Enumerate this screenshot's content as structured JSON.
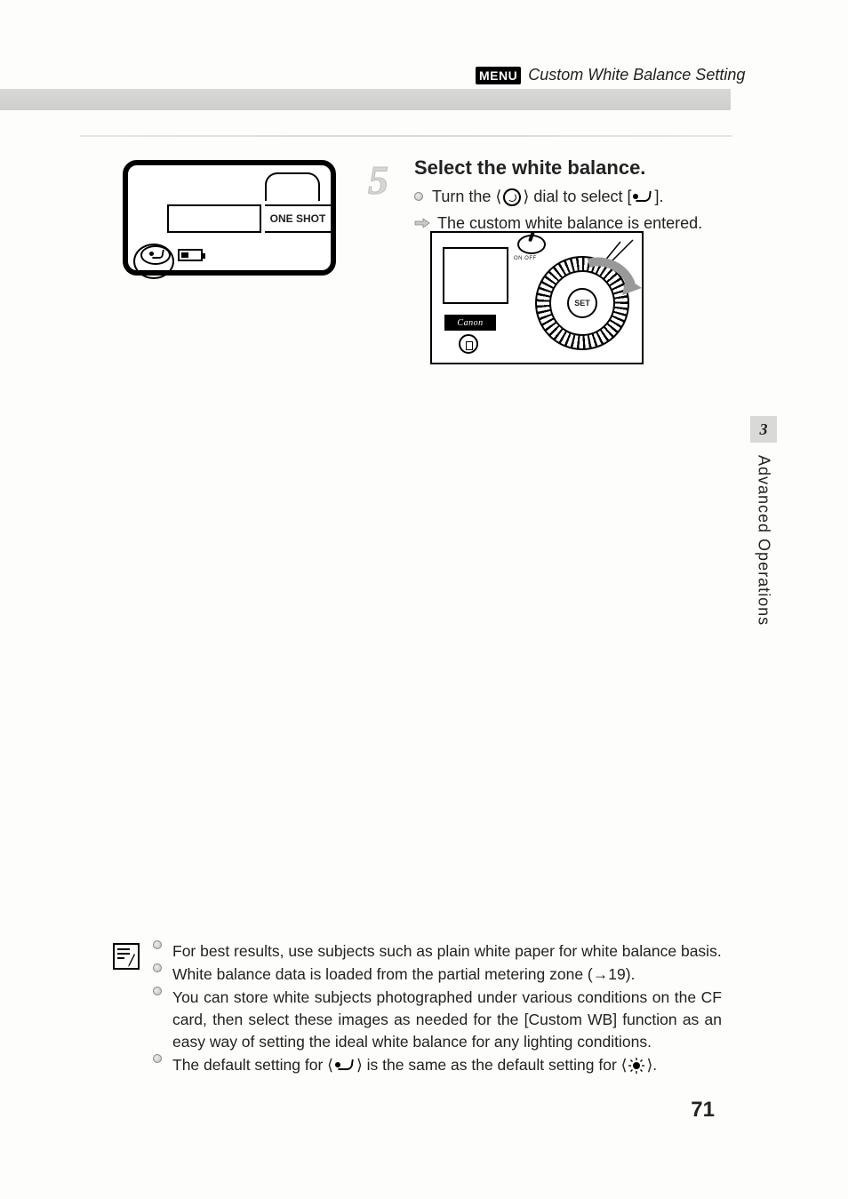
{
  "header": {
    "menu_badge": "MENU",
    "title": "Custom White Balance Setting"
  },
  "lcd": {
    "one_shot": "ONE SHOT"
  },
  "step": {
    "number": "5",
    "title": "Select the white balance.",
    "line1_pre": "Turn the ⟨",
    "line1_mid": "⟩ dial to select [",
    "line1_post": "].",
    "line2": "The custom white balance is entered."
  },
  "camera": {
    "brand": "Canon",
    "set_label": "SET",
    "on_off": "ON   OFF"
  },
  "side_tab": {
    "number": "3",
    "label": "Advanced Operations"
  },
  "notes": {
    "n1": "For best results, use subjects such as plain white paper for white balance basis.",
    "n2": "White balance data is loaded from the partial metering zone (→19).",
    "n3": "You can store white subjects photographed under various conditions on the CF card, then select these images as needed for the [Custom WB] function as an easy way of setting the ideal white balance for any lighting conditions.",
    "n4_pre": "The default setting for ⟨",
    "n4_mid": "⟩ is the same as the default setting for ⟨",
    "n4_post": "⟩."
  },
  "page_number": "71"
}
